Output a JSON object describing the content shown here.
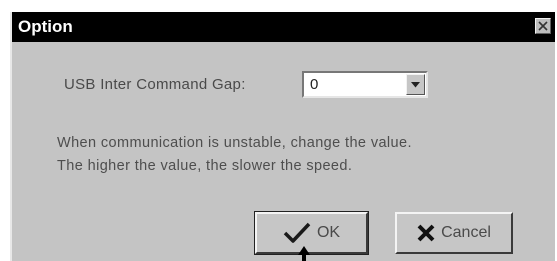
{
  "window": {
    "title": "Option"
  },
  "form": {
    "usb_label": "USB Inter Command Gap:",
    "gap_value": "0"
  },
  "message": {
    "line1": "When communication is unstable, change the value.",
    "line2": "The higher the value, the slower the speed."
  },
  "buttons": {
    "ok_label": "OK",
    "cancel_label": "Cancel"
  },
  "icons": {
    "close": "close-icon",
    "dropdown": "chevron-down-icon",
    "ok": "checkmark-icon",
    "cancel": "x-mark-icon",
    "pointer": "mouse-pointer-icon"
  },
  "colors": {
    "titlebar": "#000000",
    "dialog_bg": "#c4c4c4",
    "text": "#4a4a4a"
  }
}
